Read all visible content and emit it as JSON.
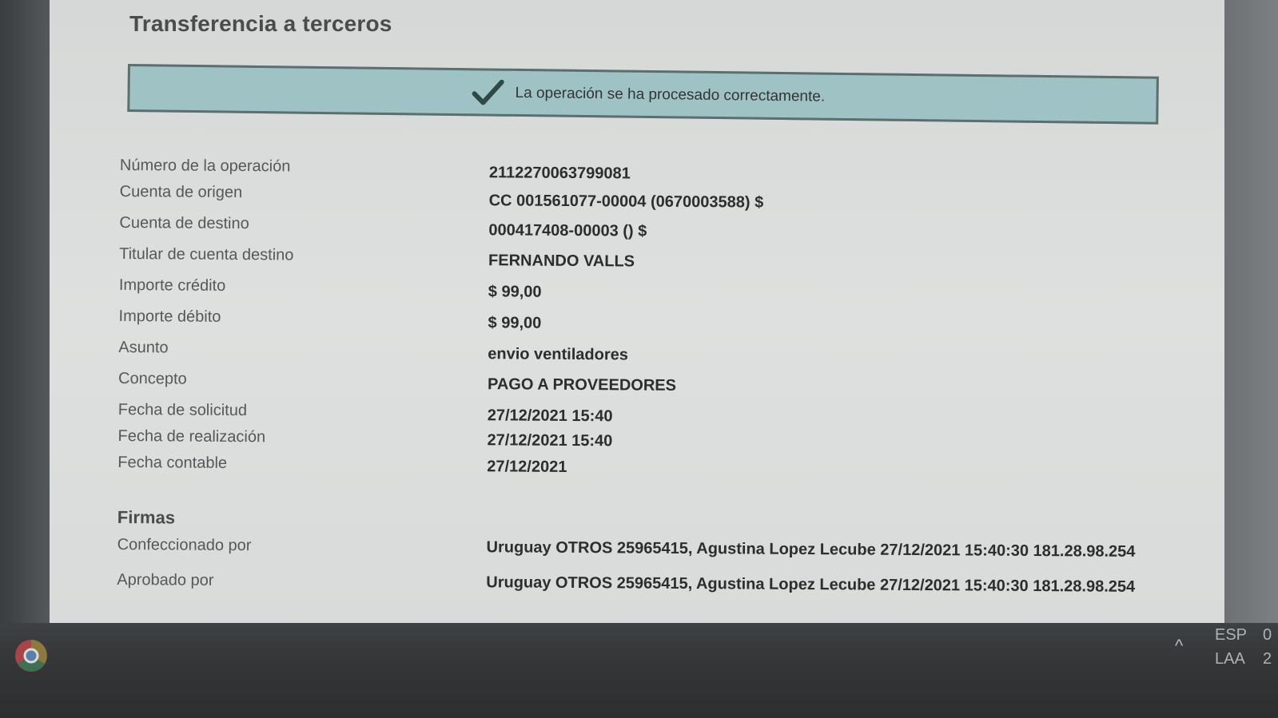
{
  "page": {
    "title": "Transferencia a terceros"
  },
  "banner": {
    "icon": "check-icon",
    "message": "La operación se ha procesado correctamente."
  },
  "details": [
    {
      "label": "Número de la operación",
      "value": "2112270063799081"
    },
    {
      "label": "Cuenta de origen",
      "value": "CC 001561077-00004 (0670003588) $"
    },
    {
      "label": "Cuenta de destino",
      "value": "000417408-00003 () $"
    },
    {
      "label": "Titular de cuenta destino",
      "value": "FERNANDO VALLS"
    },
    {
      "label": "Importe crédito",
      "value": "$ 99,00"
    },
    {
      "label": "Importe débito",
      "value": "$ 99,00"
    },
    {
      "label": "Asunto",
      "value": "envio ventiladores"
    },
    {
      "label": "Concepto",
      "value": "PAGO A PROVEEDORES"
    },
    {
      "label": "Fecha de solicitud",
      "value": "27/12/2021 15:40"
    },
    {
      "label": "Fecha de realización",
      "value": "27/12/2021 15:40"
    },
    {
      "label": "Fecha contable",
      "value": "27/12/2021"
    }
  ],
  "signatures": {
    "title": "Firmas",
    "rows": [
      {
        "label": "Confeccionado por",
        "value": "Uruguay OTROS 25965415, Agustina Lopez Lecube 27/12/2021 15:40:30 181.28.98.254"
      },
      {
        "label": "Aprobado por",
        "value": "Uruguay OTROS 25965415, Agustina Lopez Lecube 27/12/2021 15:40:30 181.28.98.254"
      }
    ]
  },
  "taskbar": {
    "start_icon": "chrome-icon",
    "tray_chevron": "^",
    "lang_top": "ESP",
    "lang_bottom": "LAA",
    "clock_top": "0",
    "clock_bottom": "2"
  },
  "colors": {
    "banner_bg": "#9fc3c4",
    "banner_border": "#5d6e6e",
    "check": "#2f4a46"
  }
}
